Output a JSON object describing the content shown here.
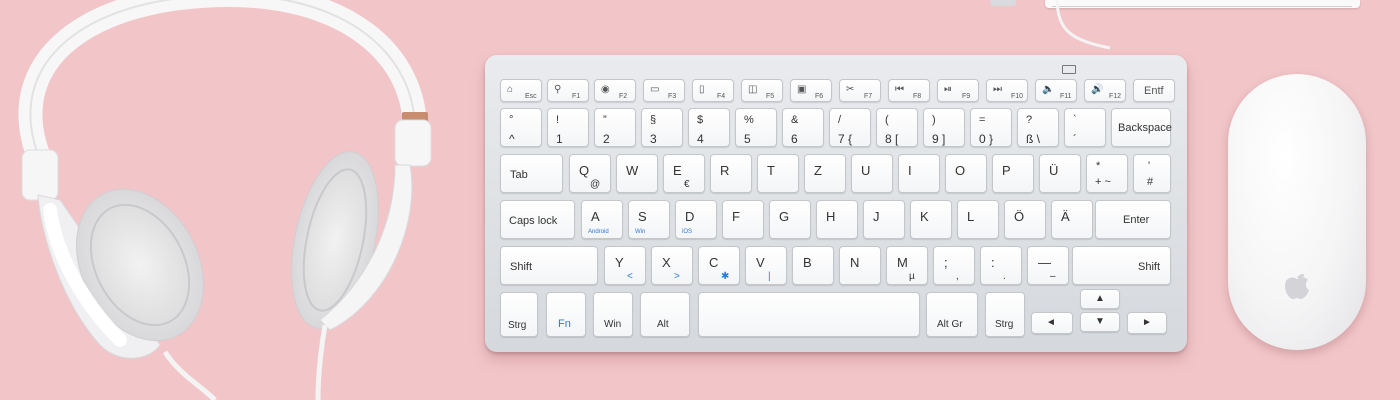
{
  "colors": {
    "background": "#f2c6c9",
    "device_white": "#ffffff",
    "fn_blue": "#2c7ad6"
  },
  "keyboard": {
    "fn_row": [
      {
        "name": "esc",
        "icon": "⌂",
        "label": "Esc"
      },
      {
        "name": "f1",
        "icon": "⚲",
        "label": "F1"
      },
      {
        "name": "f2",
        "icon": "◉",
        "label": "F2"
      },
      {
        "name": "f3",
        "icon": "▭",
        "label": "F3"
      },
      {
        "name": "f4",
        "icon": "▯",
        "label": "F4"
      },
      {
        "name": "f5",
        "icon": "◫",
        "label": "F5"
      },
      {
        "name": "f6",
        "icon": "▣",
        "label": "F6"
      },
      {
        "name": "f7",
        "icon": "✂",
        "label": "F7"
      },
      {
        "name": "f8",
        "icon": "⏮",
        "label": "F8"
      },
      {
        "name": "f9",
        "icon": "⏯",
        "label": "F9"
      },
      {
        "name": "f10",
        "icon": "⏭",
        "label": "F10"
      },
      {
        "name": "f11",
        "icon": "🔈",
        "label": "F11"
      },
      {
        "name": "f12",
        "icon": "🔊",
        "label": "F12"
      },
      {
        "name": "entf",
        "icon": "",
        "label": "Entf"
      }
    ],
    "num_row": [
      {
        "top": "°",
        "bottom": "^"
      },
      {
        "top": "!",
        "bottom": "1"
      },
      {
        "top": "”",
        "bottom": "2"
      },
      {
        "top": "§",
        "bottom": "3"
      },
      {
        "top": "$",
        "bottom": "4"
      },
      {
        "top": "%",
        "bottom": "5"
      },
      {
        "top": "&",
        "bottom": "6"
      },
      {
        "top": "/",
        "bottom": "7  {"
      },
      {
        "top": "(",
        "bottom": "8  ["
      },
      {
        "top": ")",
        "bottom": "9  ]"
      },
      {
        "top": "=",
        "bottom": "0  }"
      },
      {
        "top": "?",
        "bottom": "ß  \\"
      },
      {
        "top": "`",
        "bottom": "´"
      }
    ],
    "backspace": "Backspace",
    "tab": "Tab",
    "qwertz_row": [
      {
        "main": "Q",
        "sub": "@"
      },
      {
        "main": "W",
        "sub": ""
      },
      {
        "main": "E",
        "sub": "€"
      },
      {
        "main": "R",
        "sub": ""
      },
      {
        "main": "T",
        "sub": ""
      },
      {
        "main": "Z",
        "sub": ""
      },
      {
        "main": "U",
        "sub": ""
      },
      {
        "main": "I",
        "sub": ""
      },
      {
        "main": "O",
        "sub": ""
      },
      {
        "main": "P",
        "sub": ""
      },
      {
        "main": "Ü",
        "sub": ""
      }
    ],
    "plus_key": {
      "top": "*",
      "bottom": "+  ~"
    },
    "hash_key": {
      "top": "'",
      "bottom": "#"
    },
    "caps": "Caps lock",
    "asdf_row": [
      {
        "main": "A",
        "sub": "Android"
      },
      {
        "main": "S",
        "sub": "Win"
      },
      {
        "main": "D",
        "sub": "iOS"
      },
      {
        "main": "F",
        "sub": ""
      },
      {
        "main": "G",
        "sub": ""
      },
      {
        "main": "H",
        "sub": ""
      },
      {
        "main": "J",
        "sub": ""
      },
      {
        "main": "K",
        "sub": ""
      },
      {
        "main": "L",
        "sub": ""
      },
      {
        "main": "Ö",
        "sub": ""
      },
      {
        "main": "Ä",
        "sub": ""
      }
    ],
    "enter": "Enter",
    "shift_left": "Shift",
    "yxcv_row": [
      {
        "main": "Y",
        "sub": "<"
      },
      {
        "main": "X",
        "sub": ">"
      },
      {
        "main": "C",
        "sub": "✱"
      },
      {
        "main": "V",
        "sub": "|"
      },
      {
        "main": "B",
        "sub": ""
      },
      {
        "main": "N",
        "sub": ""
      },
      {
        "main": "M",
        "sub": "µ"
      },
      {
        "main": ";",
        "sub": ","
      },
      {
        "main": ":",
        "sub": "."
      },
      {
        "main": "—",
        "sub": "–"
      }
    ],
    "shift_right": "Shift",
    "bottom_row": {
      "strg_left": "Strg",
      "fn": "Fn",
      "win": "Win",
      "alt": "Alt",
      "alt_gr": "Alt Gr",
      "strg_right": "Strg",
      "arrow_up": "▲",
      "arrow_down": "▼",
      "arrow_left": "◄",
      "arrow_right": "►"
    }
  }
}
